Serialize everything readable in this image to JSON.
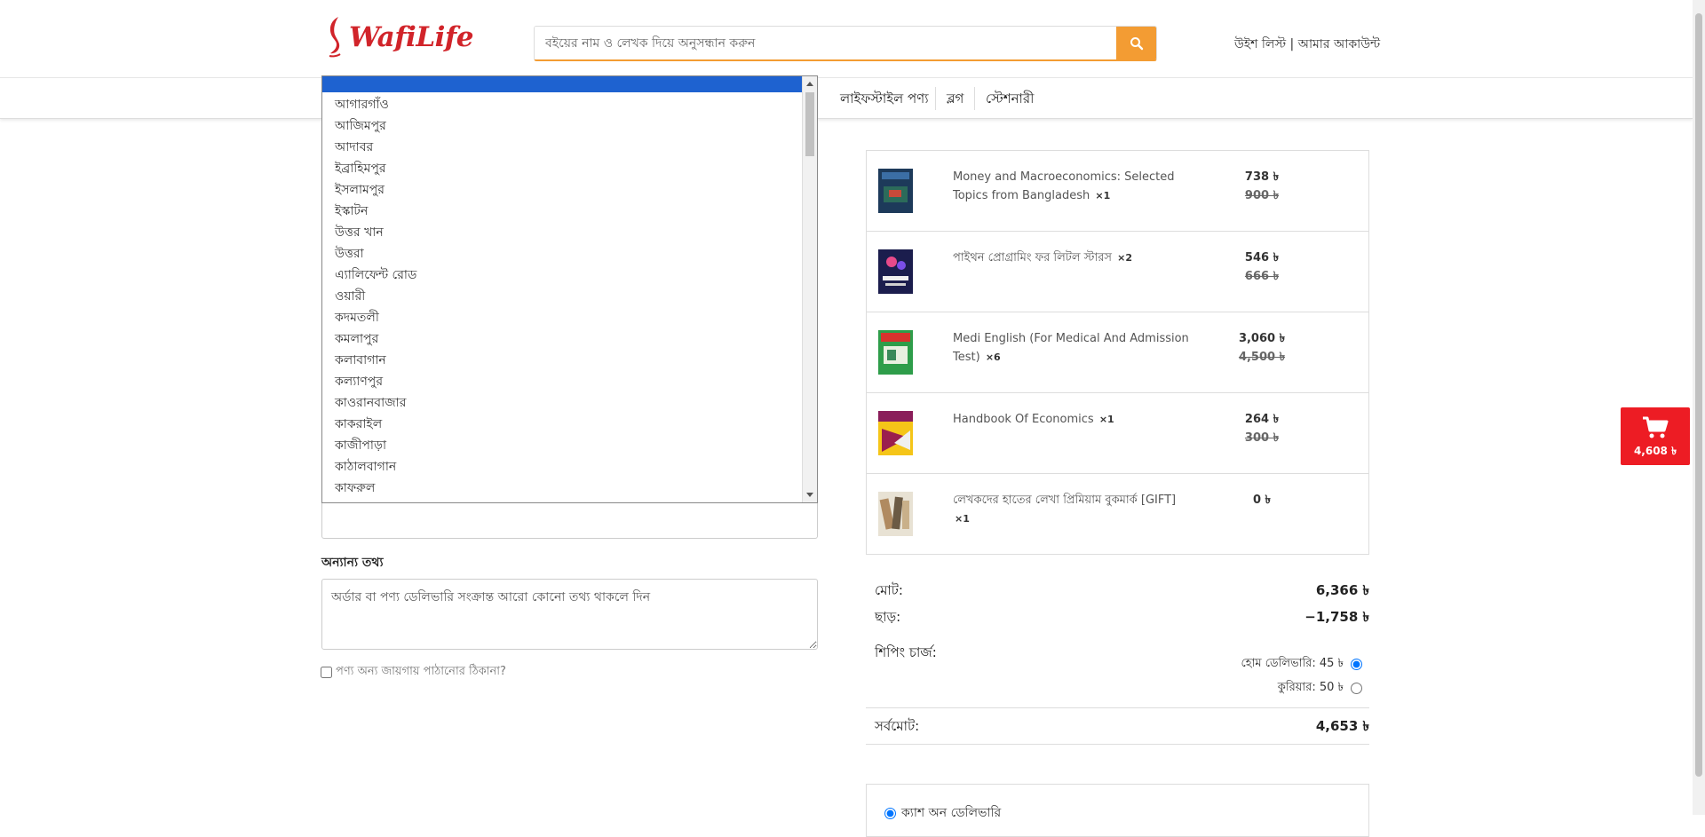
{
  "header": {
    "logo_text": "WafiLife",
    "search_placeholder": "বইয়ের নাম ও লেখক দিয়ে অনুসন্ধান করুন",
    "wishlist": "উইশ লিস্ট",
    "separator": " | ",
    "account": "আমার আকাউন্ট"
  },
  "nav": {
    "items": [
      "লাইফস্টাইল পণ্য",
      "ব্লগ",
      "স্টেশনারী"
    ]
  },
  "dropdown": {
    "options": [
      "আগারগাঁও",
      "আজিমপুর",
      "আদাবর",
      "ইব্রাহিমপুর",
      "ইসলামপুর",
      "ইস্কাটন",
      "উত্তর খান",
      "উত্তরা",
      "এ্যালিফেন্ট রোড",
      "ওয়ারী",
      "কদমতলী",
      "কমলাপুর",
      "কলাবাগান",
      "কল্যাণপুর",
      "কাওরানবাজার",
      "কাকরাইল",
      "কাজীপাড়া",
      "কাঠালবাগান",
      "কাফরুল"
    ]
  },
  "form": {
    "other_info_label": "অন্যান্য তথ্য",
    "other_info_placeholder": "অর্ডার বা পণ্য ডেলিভারি সংক্রান্ত আরো কোনো তথ্য থাকলে দিন",
    "alt_address_label": "পণ্য অন্য জায়গায় পাঠানোর ঠিকানা?"
  },
  "cart": {
    "items": [
      {
        "title": "Money and Macroeconomics: Selected Topics from Bangladesh",
        "qty": "×1",
        "price": "738 ৳",
        "old_price": "900 ৳"
      },
      {
        "title": "পাইথন প্রোগ্রামিং ফর লিটল স্টারস",
        "qty": "×2",
        "price": "546 ৳",
        "old_price": "666 ৳"
      },
      {
        "title": "Medi English (For Medical And Admission Test)",
        "qty": "×6",
        "price": "3,060 ৳",
        "old_price": "4,500 ৳"
      },
      {
        "title": "Handbook Of Economics",
        "qty": "×1",
        "price": "264 ৳",
        "old_price": "300 ৳"
      },
      {
        "title": "লেখকদের হাতের লেখা প্রিমিয়াম বুকমার্ক [GIFT]",
        "qty": "×1",
        "price": "0 ৳",
        "old_price": ""
      }
    ]
  },
  "totals": {
    "subtotal_label": "মোট:",
    "subtotal": "6,366 ৳",
    "discount_label": "ছাড়:",
    "discount": "−1,758 ৳",
    "shipping_label": "শিপিং চার্জ:",
    "ship_home": "হোম ডেলিভারি: 45 ৳",
    "ship_courier": "কুরিয়ার: 50 ৳",
    "grand_label": "সর্বমোট:",
    "grand": "4,653 ৳"
  },
  "payment": {
    "cod": "ক্যাশ অন ডেলিভারি"
  },
  "float_cart": {
    "total": "4,608 ৳"
  },
  "colors": {
    "brand_red": "#d1242a",
    "search_orange": "#f39c33",
    "float_cart_red": "#ed1c24",
    "selected_blue": "#1e62d0"
  }
}
